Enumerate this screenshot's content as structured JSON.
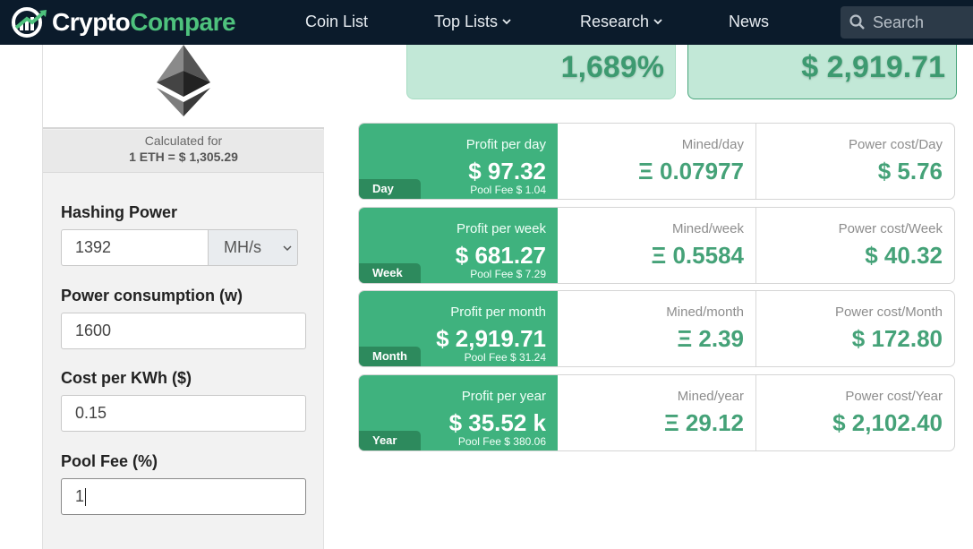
{
  "nav": {
    "logo_part1": "Crypto",
    "logo_part2": "Compare",
    "items": [
      {
        "label": "Coin List"
      },
      {
        "label": "Top Lists"
      },
      {
        "label": "Research"
      },
      {
        "label": "News"
      }
    ],
    "search_placeholder": "Search"
  },
  "calculator": {
    "calculated_for": "Calculated for",
    "rate": "1 ETH = $ 1,305.29",
    "hashing_power_label": "Hashing Power",
    "hashing_power_value": "1392",
    "hashing_unit": "MH/s",
    "power_label": "Power consumption (w)",
    "power_value": "1600",
    "cost_label": "Cost per KWh ($)",
    "cost_value": "0.15",
    "pool_fee_label": "Pool Fee (%)",
    "pool_fee_value": "1"
  },
  "summary": {
    "roi": "1,689%",
    "profit": "$ 2,919.71"
  },
  "rows": [
    {
      "tag": "Day",
      "profit_label": "Profit per day",
      "profit": "$ 97.32",
      "fee": "Pool Fee $ 1.04",
      "mined_label": "Mined/day",
      "mined": "Ξ 0.07977",
      "power_label": "Power cost/Day",
      "power": "$ 5.76"
    },
    {
      "tag": "Week",
      "profit_label": "Profit per week",
      "profit": "$ 681.27",
      "fee": "Pool Fee $ 7.29",
      "mined_label": "Mined/week",
      "mined": "Ξ 0.5584",
      "power_label": "Power cost/Week",
      "power": "$ 40.32"
    },
    {
      "tag": "Month",
      "profit_label": "Profit per month",
      "profit": "$ 2,919.71",
      "fee": "Pool Fee $ 31.24",
      "mined_label": "Mined/month",
      "mined": "Ξ 2.39",
      "power_label": "Power cost/Month",
      "power": "$ 172.80"
    },
    {
      "tag": "Year",
      "profit_label": "Profit per year",
      "profit": "$ 35.52 k",
      "fee": "Pool Fee $ 380.06",
      "mined_label": "Mined/year",
      "mined": "Ξ 29.12",
      "power_label": "Power cost/Year",
      "power": "$ 2,102.40"
    }
  ],
  "icons": {
    "logo": "cryptocompare-logo-icon",
    "search": "search-icon",
    "chevron": "chevron-down-icon",
    "coin": "ethereum-icon"
  },
  "colors": {
    "navbar": "#0b1b2b",
    "accent_green": "#3fb27e",
    "dark_green": "#2d8a5d",
    "value_green": "#45a278",
    "summary_bg": "#c2e8d7"
  }
}
